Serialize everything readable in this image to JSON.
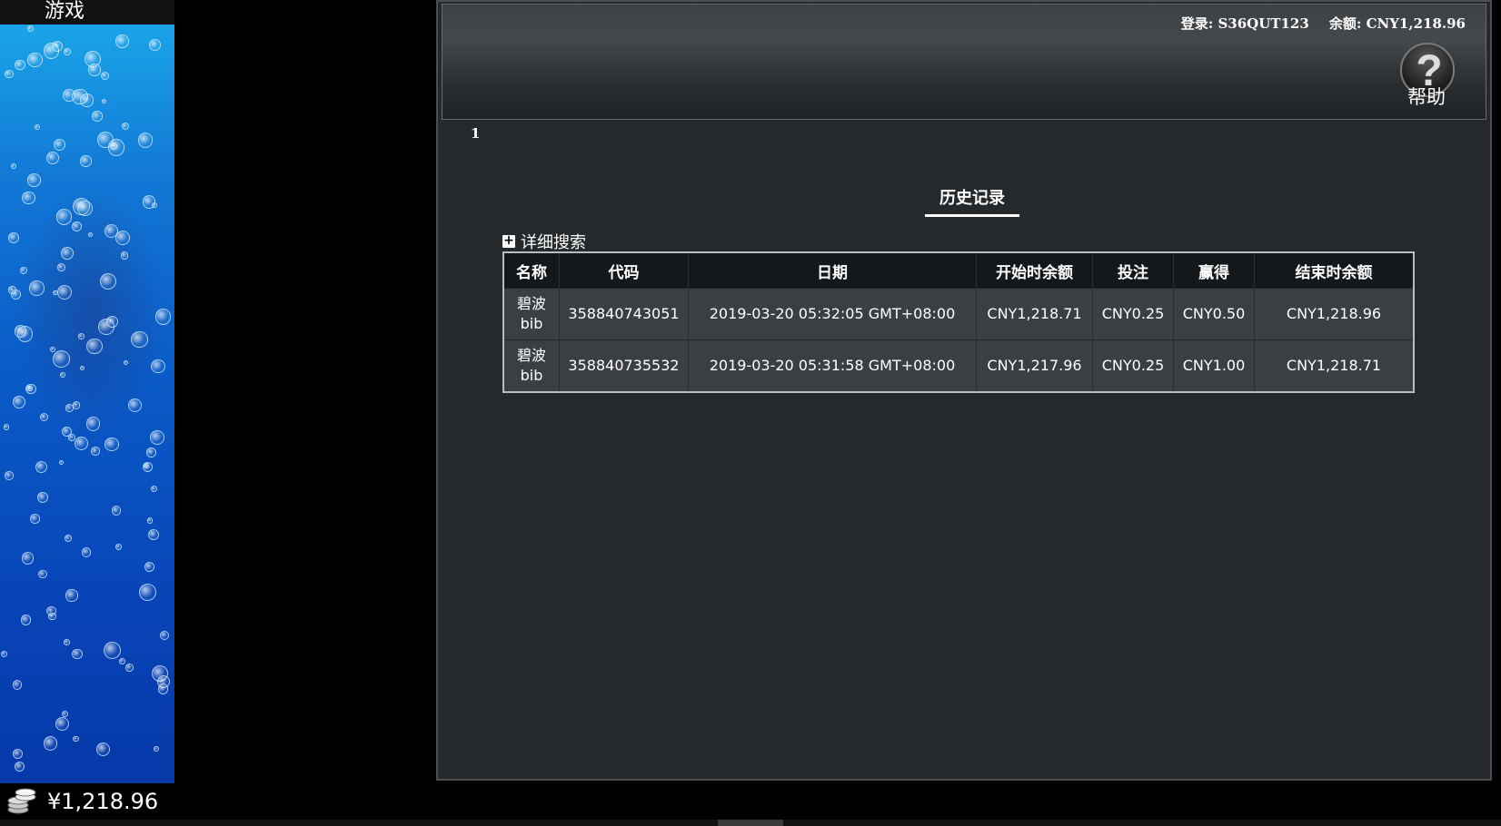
{
  "side_panel": {
    "game_tab_label": "游戏",
    "balance": "¥1,218.96"
  },
  "header": {
    "login_text": "登录: S36QUT123",
    "balance_text": "余额: CNY1,218.96",
    "help_label": "帮助"
  },
  "page_number": "1",
  "history_tab_label": "历史记录",
  "detail_search_label": "详细搜索",
  "table": {
    "columns": [
      "名称",
      "代码",
      "日期",
      "开始时余额",
      "投注",
      "赢得",
      "结束时余额"
    ],
    "rows": [
      {
        "name": "碧波",
        "name_sub": "bib",
        "code": "358840743051",
        "date": "2019-03-20 05:32:05 GMT+08:00",
        "start_balance": "CNY1,218.71",
        "bet": "CNY0.25",
        "win": "CNY0.50",
        "end_balance": "CNY1,218.96"
      },
      {
        "name": "碧波",
        "name_sub": "bib",
        "code": "358840735532",
        "date": "2019-03-20 05:31:58 GMT+08:00",
        "start_balance": "CNY1,217.96",
        "bet": "CNY0.25",
        "win": "CNY1.00",
        "end_balance": "CNY1,218.71"
      }
    ]
  }
}
